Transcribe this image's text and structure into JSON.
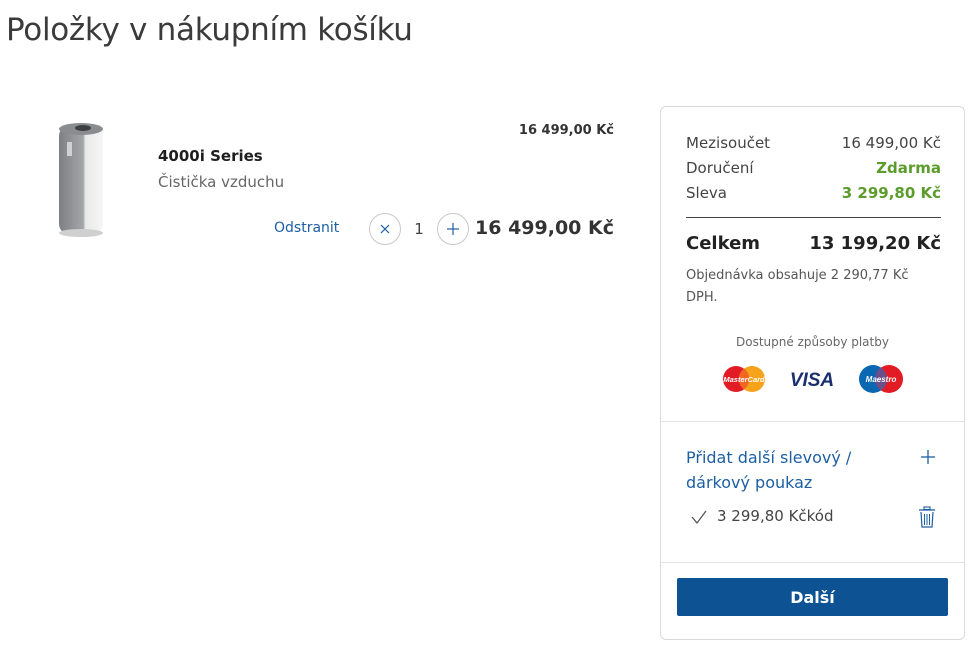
{
  "page": {
    "title": "Položky v nákupním košíku"
  },
  "cart": {
    "items": [
      {
        "name": "4000i Series",
        "subtitle": "Čistička vzduchu",
        "unit_price": "16 499,00 Kč",
        "remove_label": "Odstranit",
        "quantity": "1",
        "line_total": "16 499,00 Kč"
      }
    ]
  },
  "summary": {
    "subtotal_label": "Mezisoučet",
    "subtotal_value": "16 499,00 Kč",
    "delivery_label": "Doručení",
    "delivery_value": "Zdarma",
    "discount_label": "Sleva",
    "discount_value": "3 299,80 Kč",
    "total_label": "Celkem",
    "total_value": "13 199,20 Kč",
    "vat_note": "Objednávka obsahuje 2 290,77 Kč DPH.",
    "payment_title": "Dostupné způsoby platby",
    "payment_methods": [
      {
        "name": "mastercard",
        "label": "MasterCard"
      },
      {
        "name": "visa",
        "label": "VISA"
      },
      {
        "name": "maestro",
        "label": "Maestro"
      }
    ],
    "voucher_link": "Přidat další slevový / dárkový poukaz",
    "applied_voucher": "3 299,80 Kčkód",
    "next_label": "Další"
  },
  "colors": {
    "accent": "#0d5393",
    "link": "#1d5fa3",
    "green": "#5b9c2c"
  }
}
